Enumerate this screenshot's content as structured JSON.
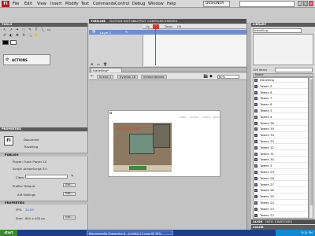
{
  "menubar": {
    "logo": "Fl",
    "items": [
      "File",
      "Edit",
      "View",
      "Insert",
      "Modify",
      "Text",
      "Commands",
      "Control",
      "Debug",
      "Window",
      "Help"
    ],
    "workspace": "DESIGNER",
    "window_buttons": [
      "_",
      "□",
      "×"
    ]
  },
  "tools_panel": {
    "title": "TOOLS",
    "tools": [
      "↖",
      "↗",
      "✦",
      "◌",
      "✎",
      "T",
      "╲",
      "▭",
      "✐",
      "◐",
      "✥",
      "⚲",
      "🔍",
      "✋"
    ],
    "actions_label": "ACTIONS"
  },
  "timeline": {
    "tabs": [
      "TIMELINE",
      "MOTION EDITOR",
      "OUTPUT",
      "COMPILER ERRORS"
    ],
    "frame_labels": [
      "Up",
      "Over",
      "Down",
      "Hit"
    ],
    "layer_name": "Layer 1"
  },
  "document": {
    "tab": "travelling*",
    "scene_crumbs": [
      "Scene 1",
      "Symbol 16",
      "lnewsrubanex"
    ],
    "zoom": "60%"
  },
  "stage": {
    "banner_title": "Indonesia",
    "site_nav": [
      "HOME",
      "GALLERY",
      "EVENTS",
      "ABOUT"
    ]
  },
  "properties": {
    "title": "PROPERTIES",
    "doc_badge": "Fl",
    "doc_type": "Document",
    "doc_name": "Travelling",
    "publish_title": "PUBLISH",
    "player": "Player: Flash Player 10",
    "script": "Script: ActionScript 3.0",
    "class_label": "Class:",
    "profile": "Profile: Default",
    "edit_btn": "Edit...",
    "air_settings": "AIR Settings",
    "properties_section": "PROPERTIES",
    "fps_label": "FPS:",
    "fps_value": "24.00",
    "size_label": "Size:",
    "size_value": "800 x 400 px"
  },
  "library": {
    "title": "LIBRARY",
    "doc": "travelling",
    "count": "105 items",
    "column_name": "Name",
    "items": [
      "travelling",
      "Tween 9",
      "Tween 8",
      "Tween 7",
      "Tween 6",
      "Tween 5",
      "Tween 4",
      "Tween 36",
      "Tween 35",
      "Tween 34",
      "Tween 33",
      "Tween 32",
      "Tween 31",
      "Tween 30",
      "Tween 3",
      "Tween 29",
      "Tween 28",
      "Tween 27",
      "Tween 26",
      "Tween 25",
      "Tween 24",
      "Tween 23",
      "Tween 22"
    ],
    "bottom_tabs": [
      "ALIGN",
      "INFO",
      "SWATCHES"
    ],
    "color_label": "COLOR"
  },
  "taskbar": {
    "start": "start",
    "task": "Macromedia Fireworks 8 - [child4-17.png @ 76% (Bitmap)]",
    "clock": "8:14 PM"
  },
  "colors": {
    "layer_highlight": "#6f8ecf",
    "playhead": "#e0392b",
    "taskbar": "#1f3e8a"
  }
}
